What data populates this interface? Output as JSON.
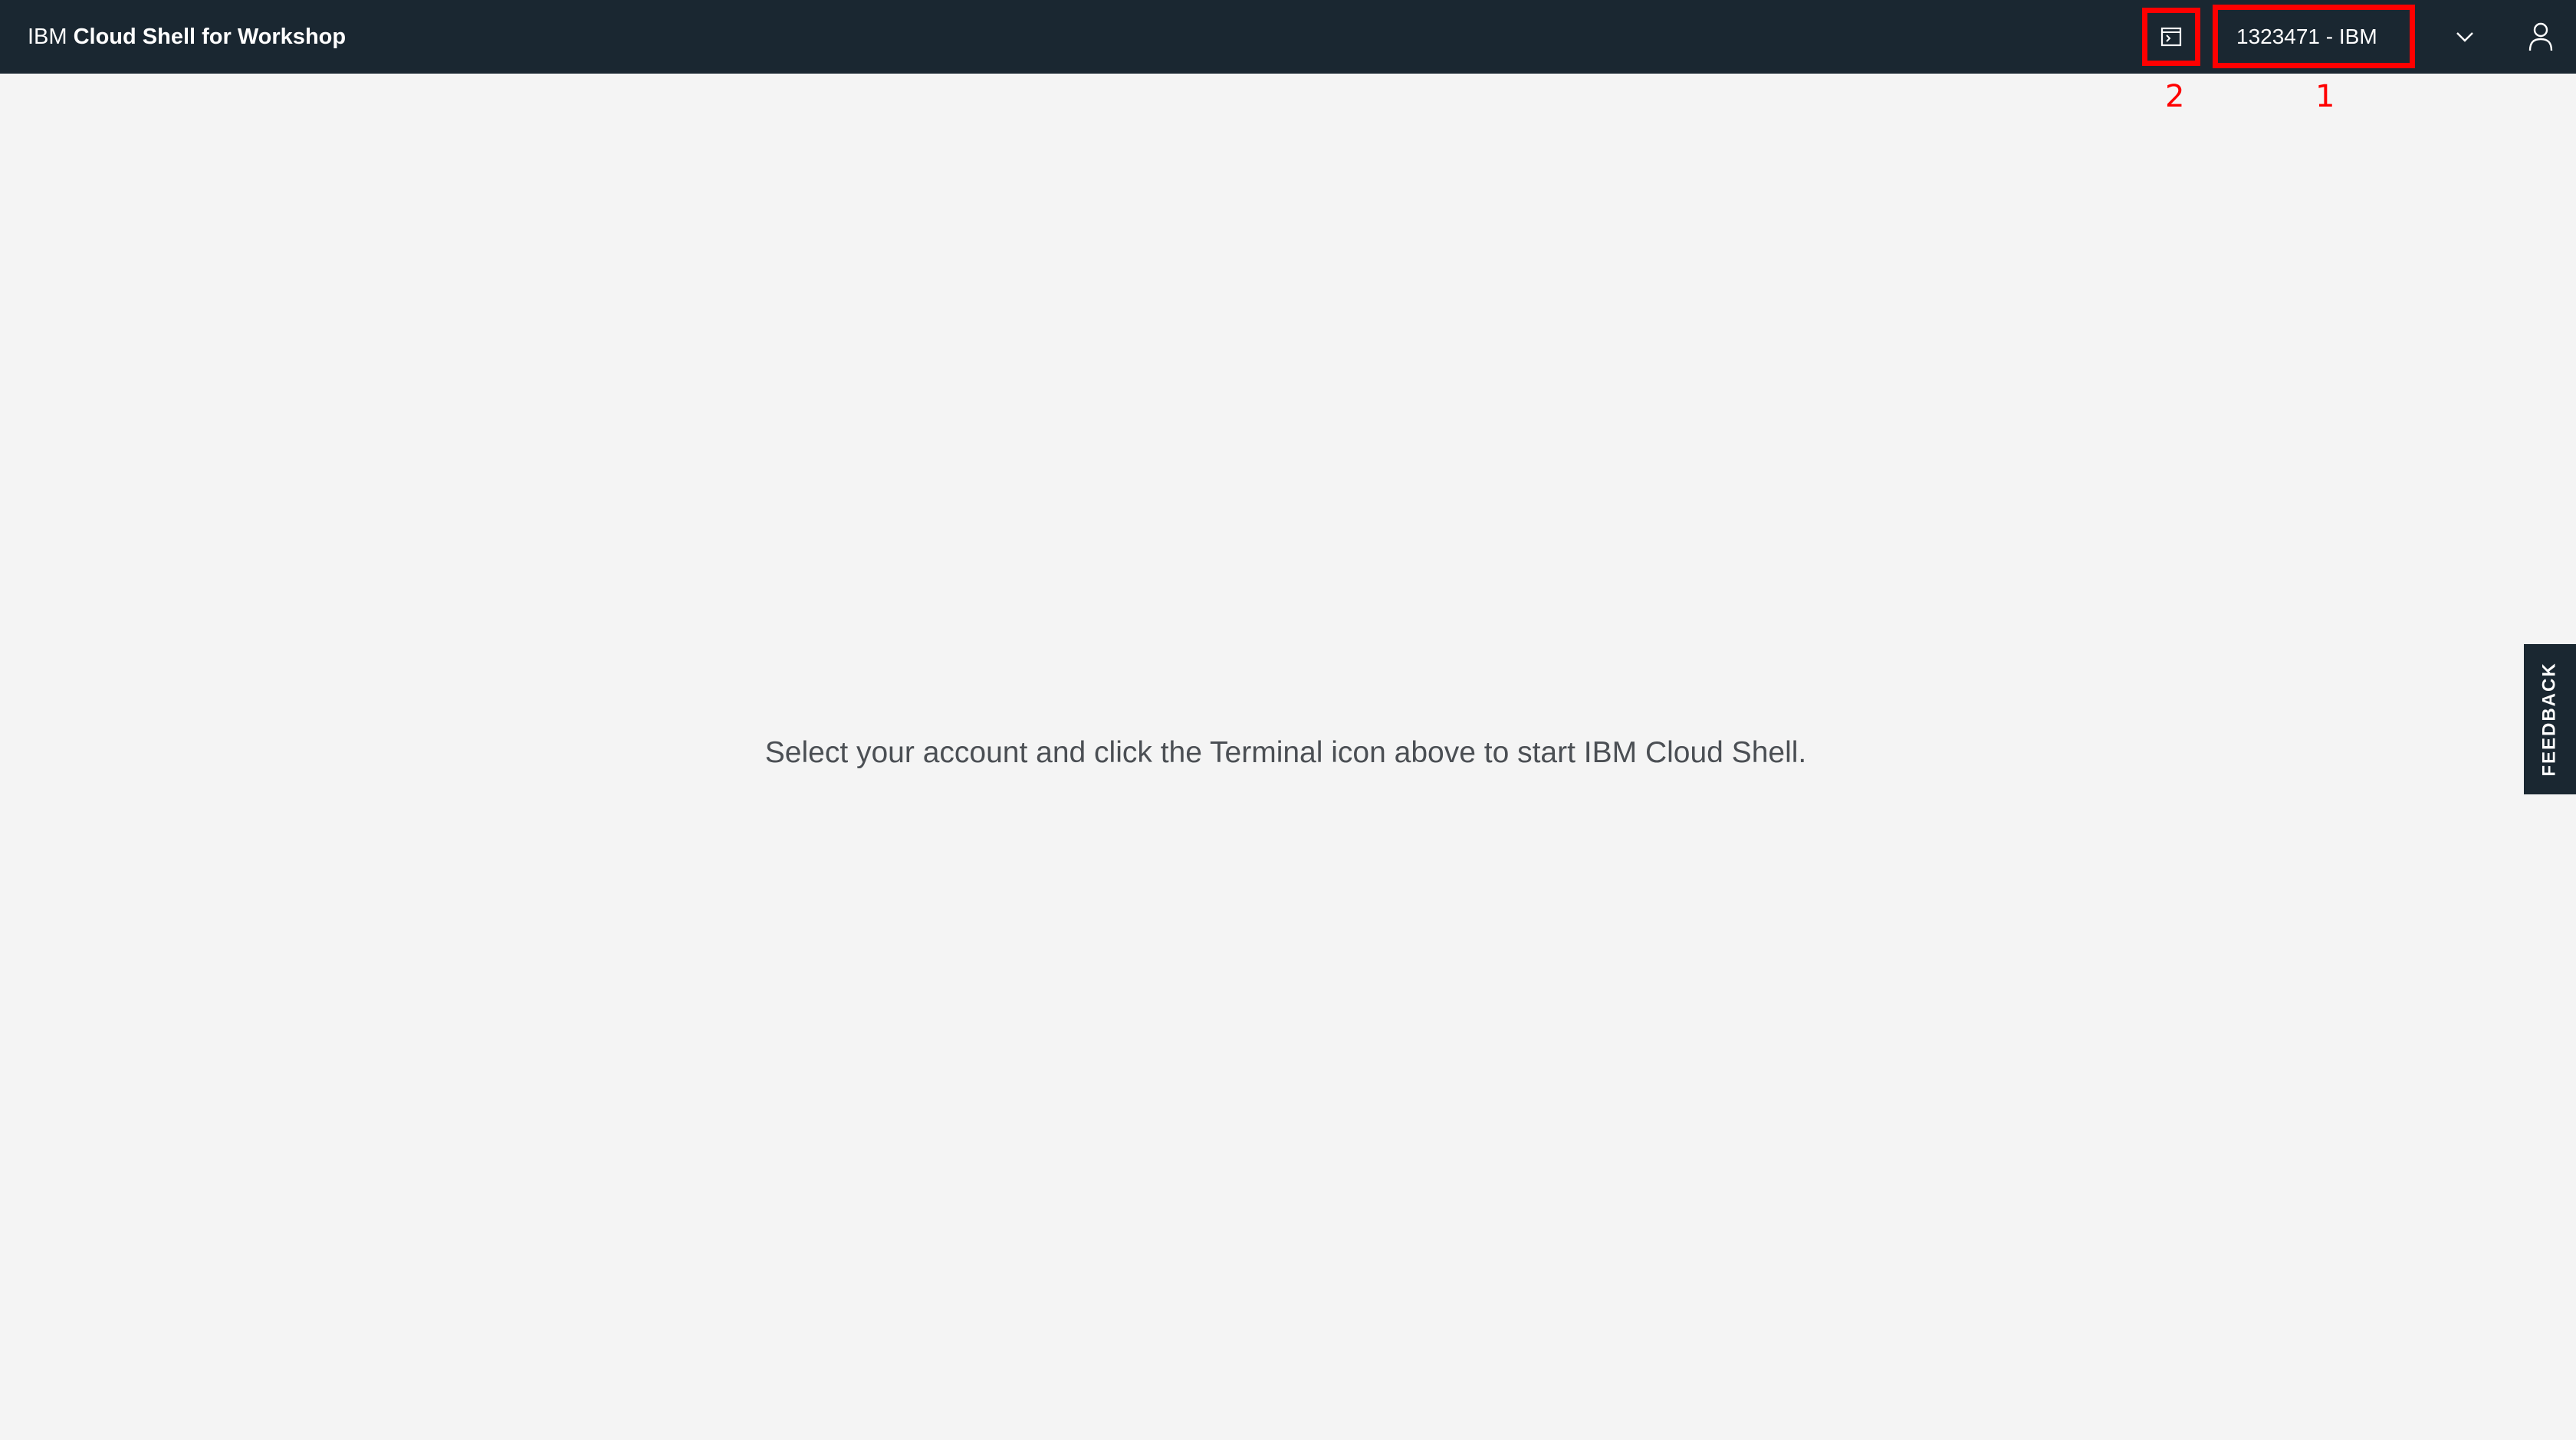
{
  "header": {
    "brand_prefix": "IBM",
    "brand_name": "Cloud Shell for Workshop",
    "account_label": "1323471 - IBM",
    "icons": {
      "terminal": "terminal-icon",
      "dropdown": "chevron-down-icon",
      "user": "user-icon"
    }
  },
  "annotations": {
    "callout_1": "1",
    "callout_2": "2",
    "highlight_color": "#ff0000"
  },
  "main": {
    "message": "Select your account and click the Terminal icon above to start IBM Cloud Shell."
  },
  "feedback": {
    "label": "FEEDBACK"
  },
  "colors": {
    "header_bg": "#1a2731",
    "page_bg": "#f4f4f4",
    "text": "#4b4f54"
  }
}
